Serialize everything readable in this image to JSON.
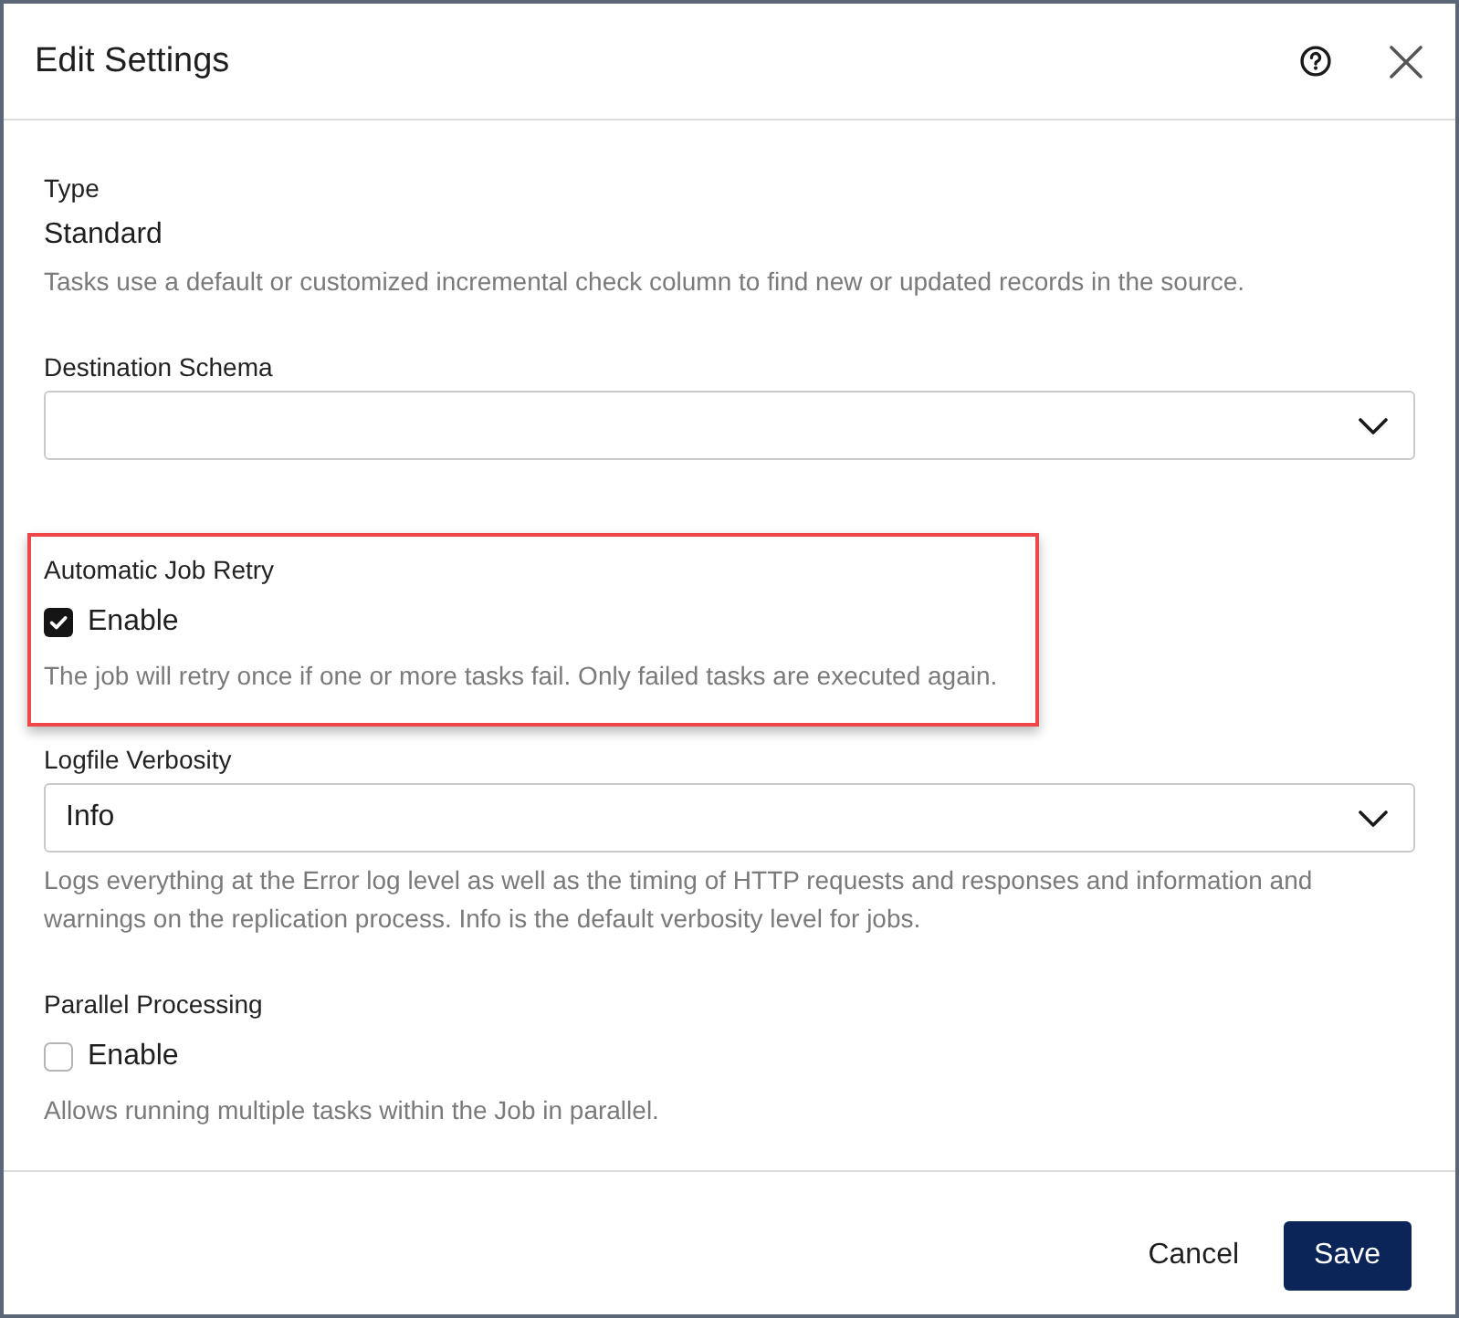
{
  "dialog": {
    "title": "Edit Settings"
  },
  "sections": [
    {
      "kind": "static",
      "label": "Type",
      "value": "Standard",
      "description": "Tasks use a default or customized incremental check column to find new or updated records in the source.",
      "highlighted": false
    },
    {
      "kind": "select",
      "label": "Destination Schema",
      "highlighted": false
    },
    {
      "kind": "checkbox",
      "label": "Automatic Job Retry",
      "option": "Enable",
      "checked": true,
      "description": "The job will retry once if one or more tasks fail. Only failed tasks are executed again.",
      "highlighted": true
    },
    {
      "kind": "select",
      "label": "Logfile Verbosity",
      "value": "Info",
      "description": "Logs everything at the Error log level as well as the timing of HTTP requests and responses and information and warnings on the replication process. Info is the default verbosity level for jobs.",
      "highlighted": false
    },
    {
      "kind": "checkbox",
      "label": "Parallel Processing",
      "option": "Enable",
      "checked": false,
      "description": "Allows running multiple tasks within the Job in parallel.",
      "highlighted": false
    }
  ],
  "buttons": [
    {
      "label": "Cancel",
      "kind": "secondary"
    },
    {
      "label": "Save",
      "kind": "primary"
    }
  ]
}
